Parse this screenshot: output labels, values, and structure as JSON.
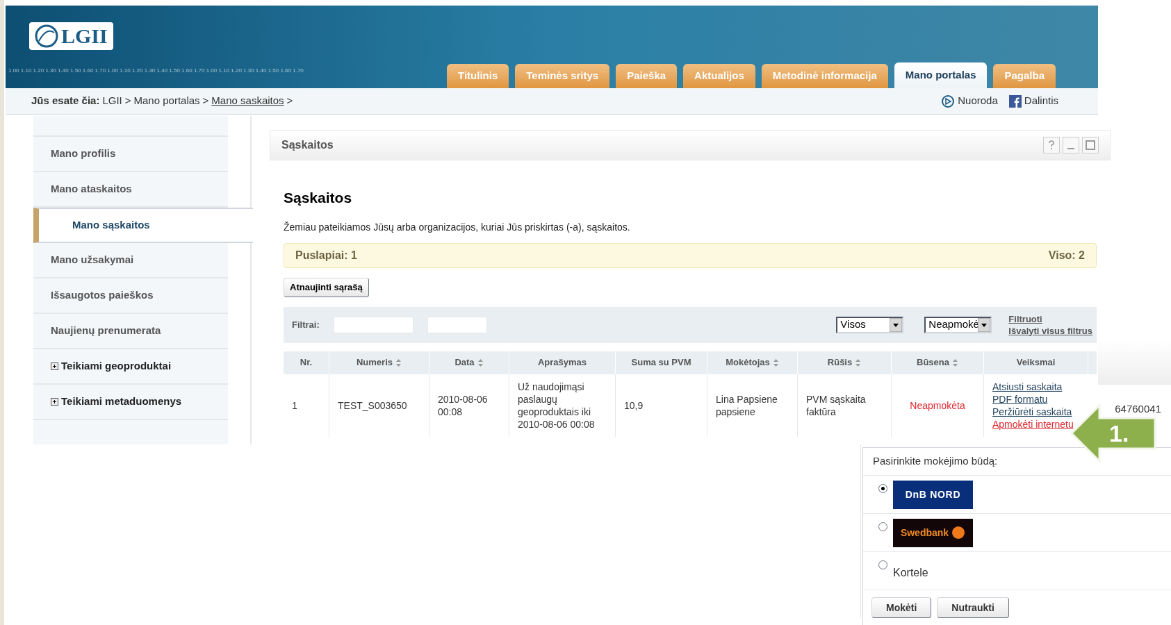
{
  "header": {
    "logo": "LGII",
    "scale_text": "1.00 1.10 1.20 1.30 1.40 1.50 1.60 1.70 1.00 1.10 1.20 1.30 1.40 1.50 1.60 1.70 1.00 1.10 1.20 1.30 1.40 1.50 1.60 1.70",
    "tabs": [
      {
        "label": "Titulinis",
        "selected": false
      },
      {
        "label": "Teminės sritys",
        "selected": false
      },
      {
        "label": "Paieška",
        "selected": false
      },
      {
        "label": "Aktualijos",
        "selected": false
      },
      {
        "label": "Metodinė informacija",
        "selected": false
      },
      {
        "label": "Mano portalas",
        "selected": true
      },
      {
        "label": "Pagalba",
        "selected": false
      }
    ]
  },
  "breadcrumb": {
    "label": "Jūs esate čia:",
    "items": [
      {
        "text": "LGII",
        "link": false
      },
      {
        "text": "Mano portalas",
        "link": false
      },
      {
        "text": "Mano saskaitos",
        "link": true
      }
    ],
    "separator": ">"
  },
  "top_links": [
    "Nuoroda",
    "Dalintis"
  ],
  "sidebar": {
    "items": [
      {
        "label": "Mano profilis",
        "selected": false,
        "expandable": false
      },
      {
        "label": "Mano ataskaitos",
        "selected": false,
        "expandable": false
      },
      {
        "label": "Mano sąskaitos",
        "selected": true,
        "expandable": false
      },
      {
        "label": "Mano užsakymai",
        "selected": false,
        "expandable": false
      },
      {
        "label": "Išsaugotos paieškos",
        "selected": false,
        "expandable": false
      },
      {
        "label": "Naujienų prenumerata",
        "selected": false,
        "expandable": false
      },
      {
        "label": "Teikiami geoproduktai",
        "selected": false,
        "expandable": true
      },
      {
        "label": "Teikiami metaduomenys",
        "selected": false,
        "expandable": true
      }
    ]
  },
  "portlet": {
    "title": "Sąskaitos",
    "heading": "Sąskaitos",
    "description": "Žemiau pateikiamos Jūsų arba organizacijos, kuriai Jūs priskirtas (-a), sąskaitos.",
    "pages": "Puslapiai: 1",
    "total": "Viso: 2",
    "refresh_button": "Atnaujinti sąrašą",
    "filters": {
      "label": "Filtrai:",
      "select_1": "Visos",
      "select_2": "Neapmokė",
      "apply": "Filtruoti",
      "clear": "Išvalyti visus filtrus"
    },
    "table": {
      "columns": [
        {
          "label": "Nr.",
          "sortable": false
        },
        {
          "label": "Numeris",
          "sortable": true
        },
        {
          "label": "Data",
          "sortable": true
        },
        {
          "label": "Aprašymas",
          "sortable": false
        },
        {
          "label": "Suma su PVM",
          "sortable": false
        },
        {
          "label": "Mokėtojas",
          "sortable": true
        },
        {
          "label": "Rūšis",
          "sortable": true
        },
        {
          "label": "Būsena",
          "sortable": true
        },
        {
          "label": "Veiksmai",
          "sortable": false
        }
      ],
      "rows": [
        {
          "cells": [
            "1",
            "TEST_S003650",
            "2010-08-06 00:08",
            "Už naudojimąsi paslaugų geoproduktais iki 2010-08-06 00:08",
            "10,9",
            "Lina Papsiene papsiene",
            "PVM sąskaita faktūra",
            "Neapmokėta"
          ],
          "actions": [
            {
              "text": "Atsiusti saskaita PDF formatu",
              "highlighted": false
            },
            {
              "text": "Peržiūrėti saskaita",
              "highlighted": false
            },
            {
              "text": "Apmokėti internetu",
              "highlighted": true
            }
          ]
        }
      ]
    }
  },
  "payment_window": {
    "fragment": "64760041",
    "prompt": "Pasirinkite mokėjimo būdą:",
    "options": [
      {
        "kind": "bank",
        "label": "DnB NORD",
        "selected": true
      },
      {
        "kind": "bank",
        "label": "Swedbank",
        "selected": false
      },
      {
        "kind": "text",
        "label": "Kortele",
        "selected": false
      }
    ],
    "buttons": [
      "Mokėti",
      "Nutraukti"
    ]
  },
  "callout": {
    "label": "1."
  }
}
